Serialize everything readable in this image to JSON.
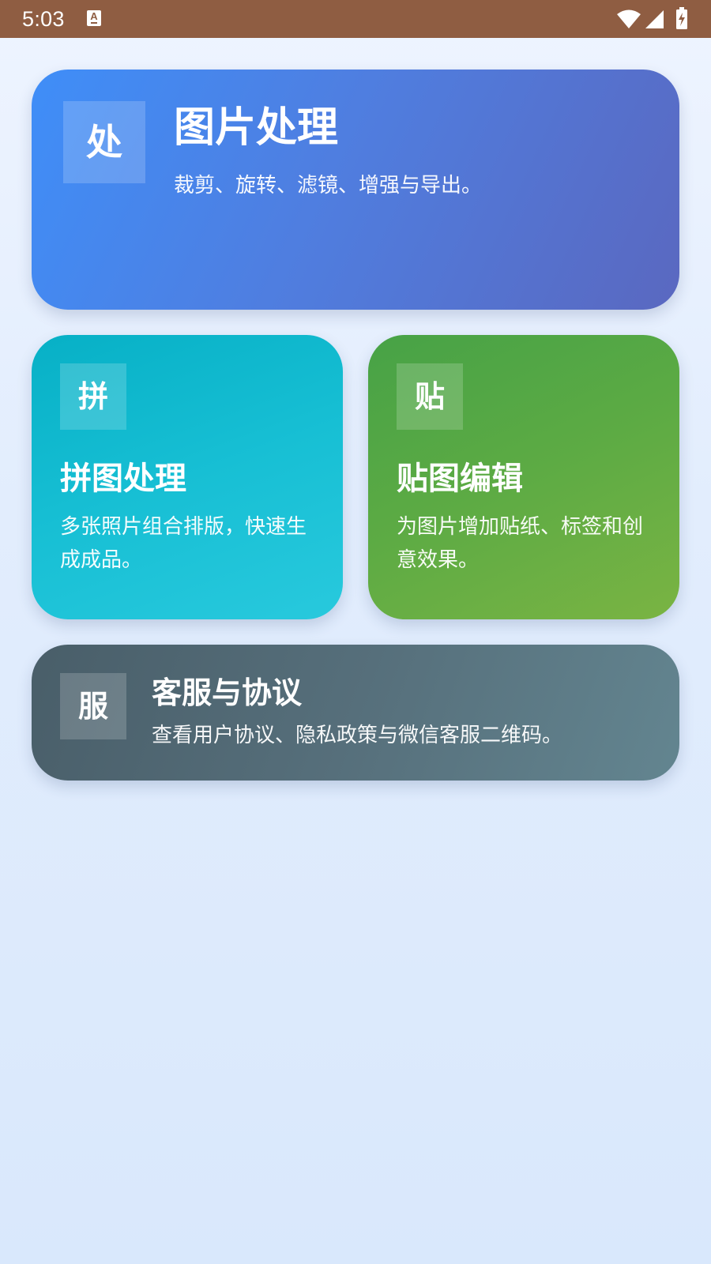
{
  "status_bar": {
    "time": "5:03",
    "notification_icon": "a-keyboard-icon",
    "notification_glyph": "A",
    "icons": [
      "wifi-icon",
      "signal-icon",
      "battery-charging-icon"
    ]
  },
  "cards": {
    "image": {
      "glyph": "处",
      "title": "图片处理",
      "description": "裁剪、旋转、滤镜、增强与导出。",
      "colors": [
        "#3f8ef8",
        "#5a68c0"
      ]
    },
    "collage": {
      "glyph": "拼",
      "title": "拼图处理",
      "description": "多张照片组合排版，快速生成成品。",
      "colors": [
        "#07b0c6",
        "#28c9dd"
      ]
    },
    "sticker": {
      "glyph": "贴",
      "title": "贴图编辑",
      "description": "为图片增加贴纸、标签和创意效果。",
      "colors": [
        "#47a246",
        "#7ab443"
      ]
    },
    "service": {
      "glyph": "服",
      "title": "客服与协议",
      "description": "查看用户协议、隐私政策与微信客服二维码。",
      "colors": [
        "#495e69",
        "#638590"
      ]
    }
  },
  "colors": {
    "status_bar": "#8f5d42",
    "background_top": "#eef4ff",
    "background_bottom": "#d9e8fc"
  }
}
